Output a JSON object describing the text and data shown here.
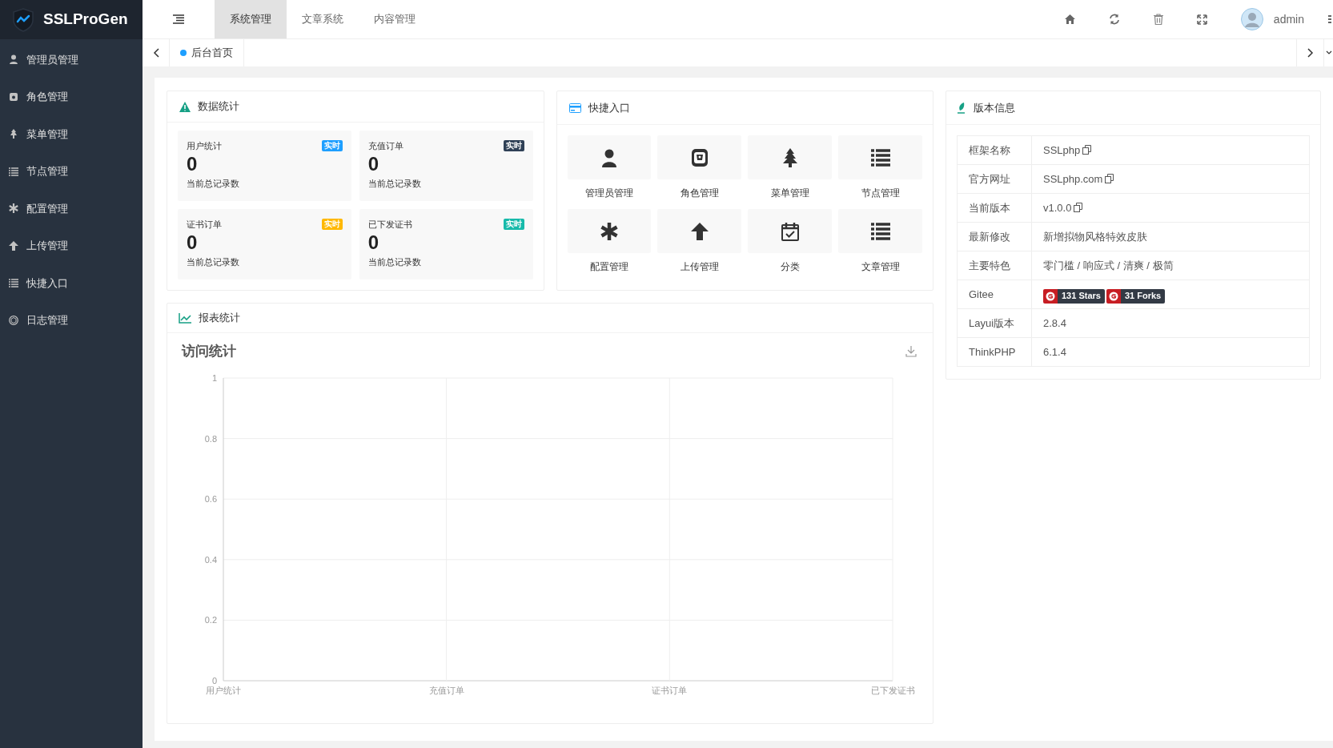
{
  "sidebar": {
    "logo": "SSLProGen",
    "items": [
      {
        "label": "管理员管理"
      },
      {
        "label": "角色管理"
      },
      {
        "label": "菜单管理"
      },
      {
        "label": "节点管理"
      },
      {
        "label": "配置管理"
      },
      {
        "label": "上传管理"
      },
      {
        "label": "快捷入口"
      },
      {
        "label": "日志管理"
      }
    ]
  },
  "top_tabs": [
    {
      "label": "系统管理",
      "selected": true
    },
    {
      "label": "文章系统",
      "selected": false
    },
    {
      "label": "内容管理",
      "selected": false
    }
  ],
  "user": {
    "name": "admin"
  },
  "page_tabs": [
    {
      "label": "后台首页",
      "selected": true
    }
  ],
  "stats_panel": {
    "title": "数据统计",
    "cards": [
      {
        "label": "用户统计",
        "badge": "实时",
        "color": "#1e9fff",
        "value": "0",
        "caption": "当前总记录数"
      },
      {
        "label": "充值订单",
        "badge": "实时",
        "color": "#2f4056",
        "value": "0",
        "caption": "当前总记录数"
      },
      {
        "label": "证书订单",
        "badge": "实时",
        "color": "#ffb800",
        "value": "0",
        "caption": "当前总记录数"
      },
      {
        "label": "已下发证书",
        "badge": "实时",
        "color": "#16baaa",
        "value": "0",
        "caption": "当前总记录数"
      }
    ]
  },
  "shortcuts_panel": {
    "title": "快捷入口",
    "items": [
      {
        "label": "管理员管理"
      },
      {
        "label": "角色管理"
      },
      {
        "label": "菜单管理"
      },
      {
        "label": "节点管理"
      },
      {
        "label": "配置管理"
      },
      {
        "label": "上传管理"
      },
      {
        "label": "分类"
      },
      {
        "label": "文章管理"
      }
    ]
  },
  "version_panel": {
    "title": "版本信息",
    "rows": [
      {
        "kind": "text",
        "label": "框架名称",
        "value": "SSLphp",
        "copy": true
      },
      {
        "kind": "text",
        "label": "官方网址",
        "value": "SSLphp.com",
        "copy": true
      },
      {
        "kind": "text",
        "label": "当前版本",
        "value": "v1.0.0",
        "copy": true
      },
      {
        "kind": "text",
        "label": "最新修改",
        "value": "新增拟物风格特效皮肤",
        "copy": false
      },
      {
        "kind": "text",
        "label": "主要特色",
        "value": "零门槛 / 响应式 / 清爽 / 极简",
        "copy": false
      },
      {
        "kind": "badges",
        "label": "Gitee",
        "badges": [
          "131 Stars",
          "31 Forks"
        ]
      },
      {
        "kind": "text",
        "label": "Layui版本",
        "value": "2.8.4",
        "copy": false
      },
      {
        "kind": "text",
        "label": "ThinkPHP",
        "value": "6.1.4",
        "copy": false
      }
    ]
  },
  "report_panel": {
    "title": "报表统计",
    "chart_data": {
      "type": "line",
      "title": "访问统计",
      "grid": true,
      "categories": [
        "用户统计",
        "充值订单",
        "证书订单",
        "已下发证书"
      ],
      "ylim": [
        0,
        1
      ],
      "yticks": [
        {
          "value": 0,
          "label": "0"
        },
        {
          "value": 0.2,
          "label": "0.2"
        },
        {
          "value": 0.4,
          "label": "0.4"
        },
        {
          "value": 0.6,
          "label": "0.6"
        },
        {
          "value": 0.8,
          "label": "0.8"
        },
        {
          "value": 1,
          "label": "1"
        }
      ]
    }
  }
}
